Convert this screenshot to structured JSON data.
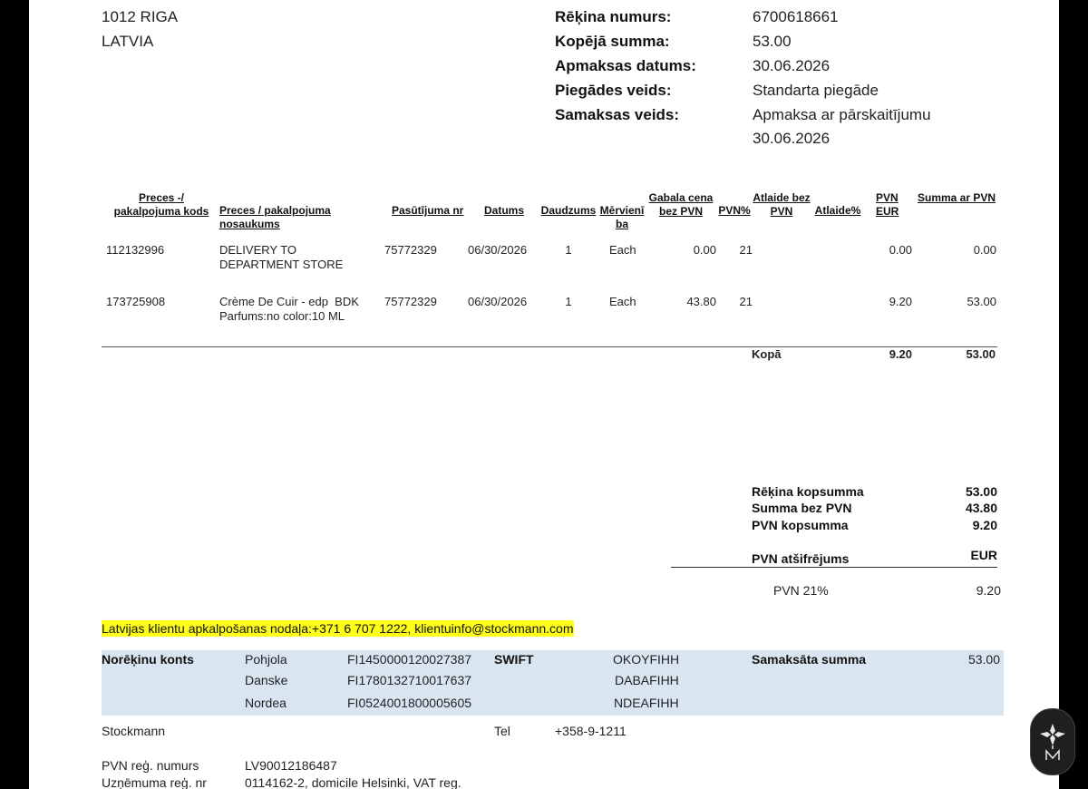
{
  "address": {
    "line1": "1012 RIGA",
    "line2": "LATVIA"
  },
  "invoice_info": [
    {
      "label": "Rēķina numurs:",
      "value": "6700618661"
    },
    {
      "label": "Kopējā summa:",
      "value": "53.00"
    },
    {
      "label": "Apmaksas datums:",
      "value": "30.06.2026"
    },
    {
      "label": "Piegādes veids:",
      "value": "Standarta piegāde"
    },
    {
      "label": "Samaksas veids:",
      "value": "Apmaksa ar pārskaitījumu"
    }
  ],
  "payment_date_extra": "30.06.2026",
  "table": {
    "headers": {
      "code": "Preces -/ pakalpojuma kods",
      "name": "Preces / pakalpojuma nosaukums",
      "order": "Pasūtījuma nr",
      "date": "Datums",
      "qty": "Daudzums",
      "unit": "Mērvienība",
      "price": "Gabala cena bez PVN",
      "vat_pct": "PVN%",
      "discount_excl": "Atlaide bez PVN",
      "discount_pct": "Atlaide%",
      "vat_eur": "PVN EUR",
      "total": "Summa ar PVN"
    },
    "rows": [
      {
        "code": "112132996",
        "name": "DELIVERY TO DEPARTMENT STORE",
        "order": "75772329",
        "date": "06/30/2026",
        "qty": "1",
        "unit": "Each",
        "price": "0.00",
        "vat_pct": "21",
        "vat_eur": "0.00",
        "total": "0.00"
      },
      {
        "code": "173725908",
        "name": "Crème De Cuir - edp  BDK Parfums:no color:10 ML",
        "order": "75772329",
        "date": "06/30/2026",
        "qty": "1",
        "unit": "Each",
        "price": "43.80",
        "vat_pct": "21",
        "vat_eur": "9.20",
        "total": "53.00"
      }
    ],
    "total_row": {
      "label": "Kopā",
      "vat": "9.20",
      "total": "53.00"
    }
  },
  "summary": [
    {
      "label": "Rēķina kopsumma",
      "value": "53.00"
    },
    {
      "label": "Summa bez PVN",
      "value": "43.80"
    },
    {
      "label": "PVN kopsumma",
      "value": "9.20"
    }
  ],
  "vat_breakdown": {
    "label": "PVN atšifrējums",
    "currency": "EUR",
    "rate_label": "PVN 21%",
    "rate_value": "9.20"
  },
  "customer_service": "Latvijas klientu apkalpošanas nodaļa:+371 6 707 1222, klientuinfo@stockmann.com",
  "bank": {
    "label": "Norēķinu konts",
    "swift_label": "SWIFT",
    "paid_label": "Samaksāta summa",
    "paid_value": "53.00",
    "accounts": [
      {
        "bank": "Pohjola",
        "iban": "FI1450000120027387",
        "swift": "OKOYFIHH"
      },
      {
        "bank": "Danske",
        "iban": "FI1780132710017637",
        "swift": "DABAFIHH"
      },
      {
        "bank": "Nordea",
        "iban": "FI0524001800005605",
        "swift": "NDEAFIHH"
      }
    ]
  },
  "footer": {
    "company": "Stockmann",
    "tel_label": "Tel",
    "tel_value": "+358-9-1211",
    "vat_reg_label": "PVN reģ. numurs",
    "vat_reg_value": "LV90012186487",
    "company_reg_label": "Uzņēmuma reģ. nr",
    "company_reg_value": "0114162-2, domicile Helsinki, VAT reg."
  },
  "icons": {
    "logo_badge": "stockmann-deer-logo-icon"
  }
}
